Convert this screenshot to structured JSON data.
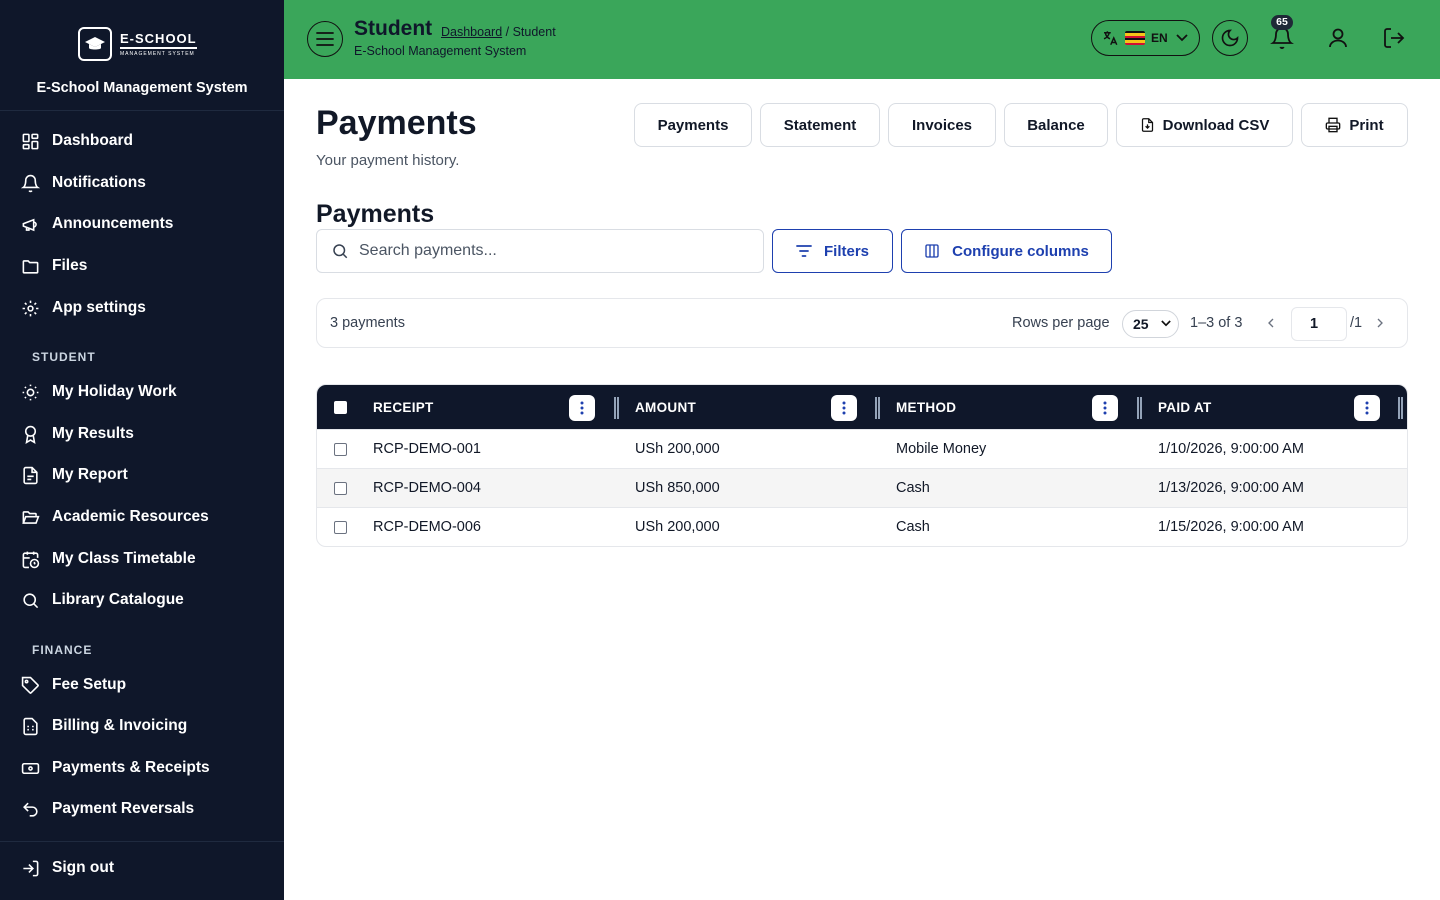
{
  "sidebar": {
    "logo_text": "E-SCHOOL",
    "logo_subtext": "MANAGEMENT SYSTEM",
    "system_name": "E-School Management System",
    "items": [
      {
        "label": "Dashboard",
        "icon": "dashboard-icon"
      },
      {
        "label": "Notifications",
        "icon": "bell-icon"
      },
      {
        "label": "Announcements",
        "icon": "megaphone-icon"
      },
      {
        "label": "Files",
        "icon": "folder-icon"
      },
      {
        "label": "App settings",
        "icon": "gear-icon"
      }
    ],
    "sections": [
      {
        "title": "STUDENT",
        "items": [
          {
            "label": "My Holiday Work",
            "icon": "sun-icon"
          },
          {
            "label": "My Results",
            "icon": "award-icon"
          },
          {
            "label": "My Report",
            "icon": "report-icon"
          },
          {
            "label": "Academic Resources",
            "icon": "folder-open-icon"
          },
          {
            "label": "My Class Timetable",
            "icon": "calendar-clock-icon"
          },
          {
            "label": "Library Catalogue",
            "icon": "search-icon"
          }
        ]
      },
      {
        "title": "FINANCE",
        "items": [
          {
            "label": "Fee Setup",
            "icon": "tag-icon"
          },
          {
            "label": "Billing & Invoicing",
            "icon": "invoice-icon"
          },
          {
            "label": "Payments & Receipts",
            "icon": "banknote-icon"
          },
          {
            "label": "Payment Reversals",
            "icon": "undo-icon"
          }
        ]
      }
    ],
    "sign_out": "Sign out"
  },
  "topbar": {
    "title": "Student",
    "breadcrumb_link": "Dashboard",
    "breadcrumb_rest": " / Student",
    "subtitle": "E-School Management System",
    "language_code": "EN",
    "notification_count": "65",
    "background_color": "#3aa65a"
  },
  "main": {
    "title": "Payments",
    "subtitle": "Your payment history.",
    "header_buttons": [
      "Payments",
      "Statement",
      "Invoices",
      "Balance",
      "Download CSV",
      "Print"
    ],
    "section_title": "Payments",
    "search_placeholder": "Search payments...",
    "filters_label": "Filters",
    "configure_label": "Configure columns",
    "accent_color": "#1e40af"
  },
  "pagination": {
    "count_text": "3 payments",
    "rows_per_page_label": "Rows per page",
    "rows_per_page_value": "25",
    "range_text": "1–3 of 3",
    "current_page": "1",
    "total_pages_text": "/1"
  },
  "table": {
    "columns": [
      "RECEIPT",
      "AMOUNT",
      "METHOD",
      "PAID AT"
    ],
    "rows": [
      {
        "receipt": "RCP-DEMO-001",
        "amount": "USh 200,000",
        "method": "Mobile Money",
        "paid_at": "1/10/2026, 9:00:00 AM"
      },
      {
        "receipt": "RCP-DEMO-004",
        "amount": "USh 850,000",
        "method": "Cash",
        "paid_at": "1/13/2026, 9:00:00 AM"
      },
      {
        "receipt": "RCP-DEMO-006",
        "amount": "USh 200,000",
        "method": "Cash",
        "paid_at": "1/15/2026, 9:00:00 AM"
      }
    ]
  }
}
